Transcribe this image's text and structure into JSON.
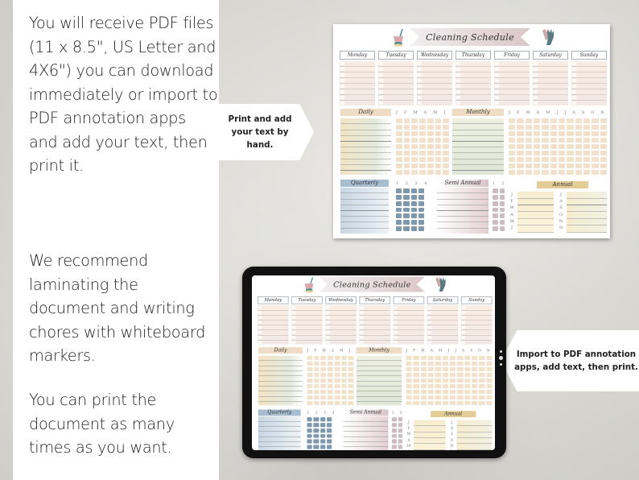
{
  "info_panel": {
    "paragraph_1": "You will receive PDF files (11 x 8.5\", US Letter and 4X6\") you can download immediately or import to PDF annotation apps and add your text, then print it.",
    "paragraph_2": "We recommend laminating the document and writing chores with whiteboard markers.",
    "paragraph_3": "You can print the document as many times as you want."
  },
  "callouts": {
    "print": "Print and add your text by hand.",
    "import": "Import to PDF annotation apps, add text, then print."
  },
  "schedule": {
    "title": "Cleaning Schedule",
    "icons": [
      "bucket-mop-icon",
      "gloves-icon"
    ],
    "days": [
      "Monday",
      "Tuesday",
      "Wednesday",
      "Thursday",
      "Friday",
      "Saturday",
      "Sunday"
    ],
    "sections": {
      "daily": "Daily",
      "monthly": "Monthly",
      "quarterly": "Quarterly",
      "semi_annual": "Semi Annual",
      "annual": "Annual"
    },
    "daily_letters": "J F M A M J J",
    "monthly_letters": "J F M A M J J A S O N D",
    "quarterly_letters": "1 2 3 4",
    "semi_annual_letters": "1 2",
    "annual_months_left": [
      "J",
      "F",
      "M",
      "A",
      "M",
      "J"
    ],
    "annual_months_right": [
      "J",
      "A",
      "S",
      "O",
      "N",
      "D"
    ]
  },
  "colors": {
    "panel": "#ffffff",
    "peach": "#f3e6d4",
    "sage": "#dfe6d8",
    "blue": "#7e98ad",
    "mauve": "#c8b3b9",
    "gold": "#e4cc96",
    "tablet_bezel": "#111111"
  }
}
